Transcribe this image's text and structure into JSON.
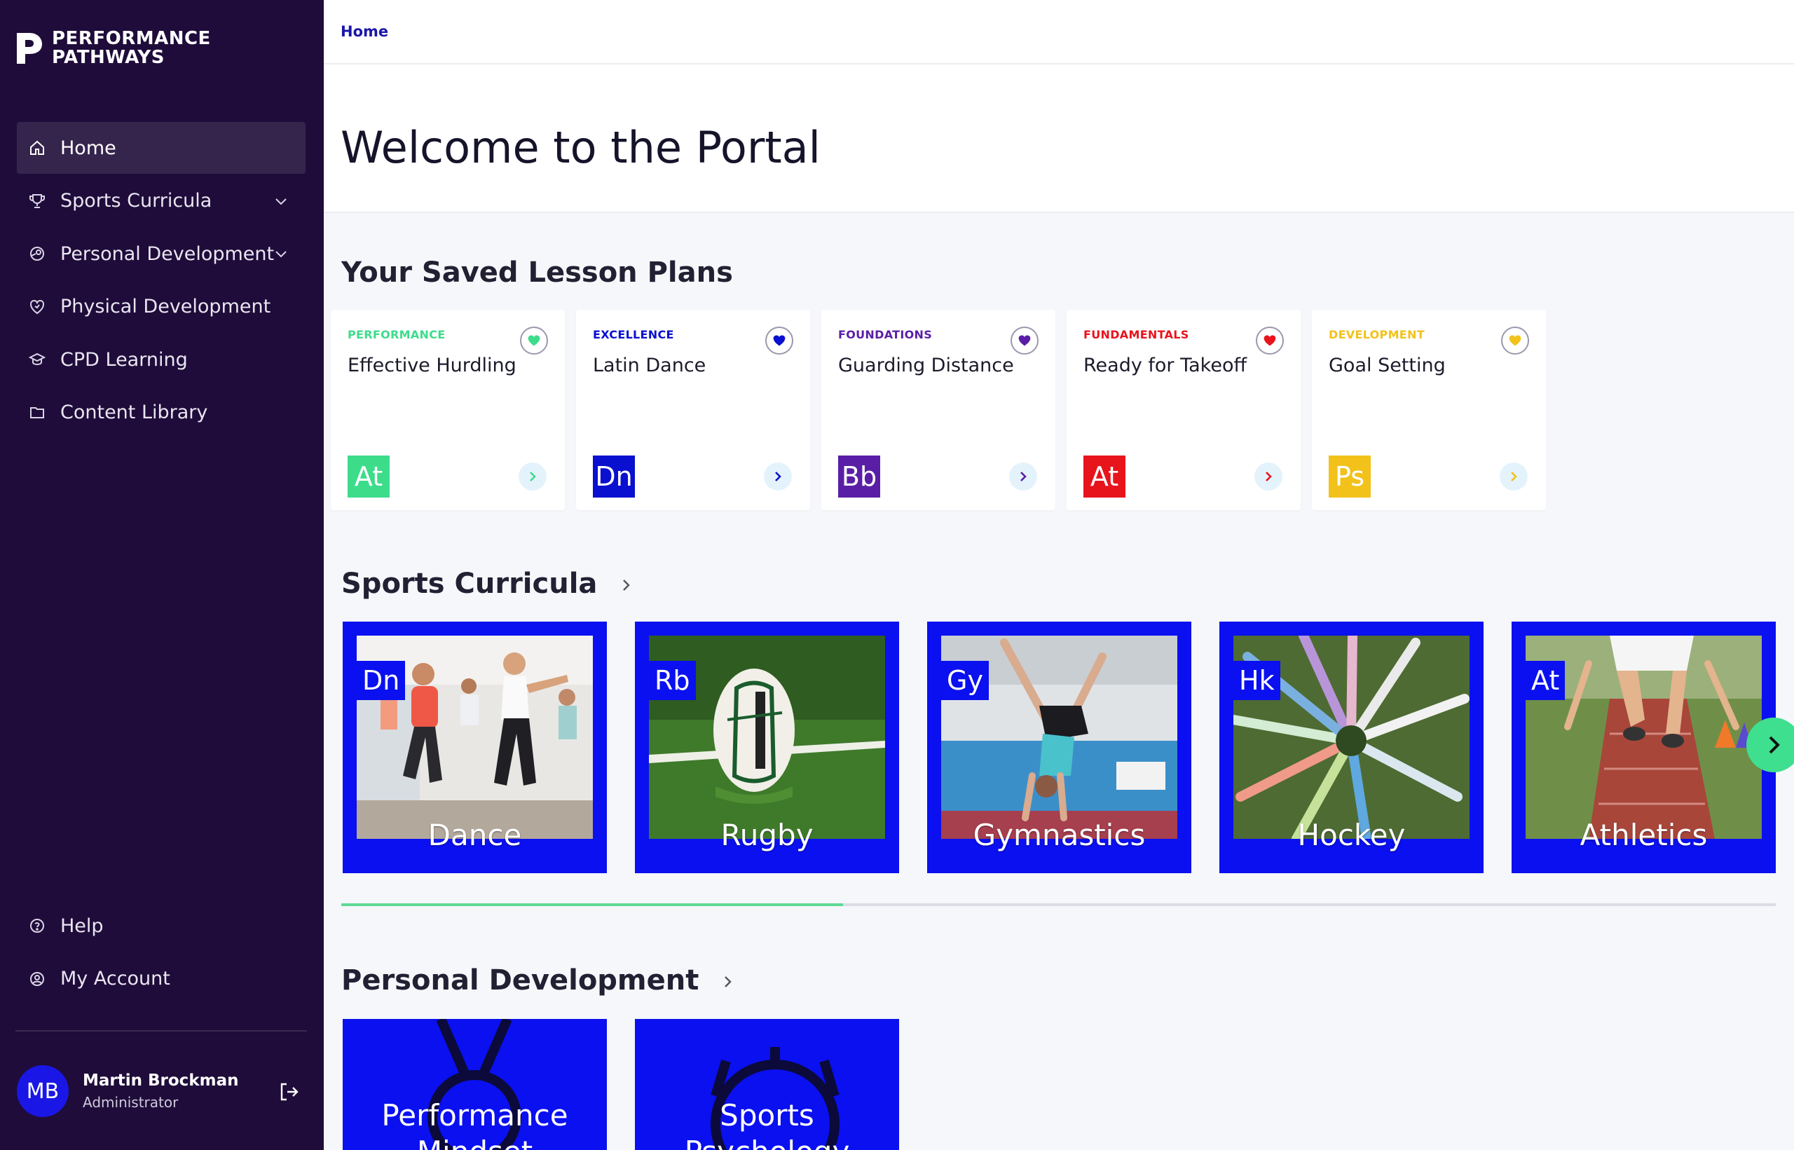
{
  "brand": {
    "line1": "PERFORMANCE",
    "line2": "PATHWAYS"
  },
  "nav": {
    "items": [
      {
        "label": "Home",
        "icon": "home-icon",
        "active": true
      },
      {
        "label": "Sports Curricula",
        "icon": "trophy-icon",
        "expandable": true
      },
      {
        "label": "Personal Development",
        "icon": "person-icon",
        "expandable": true
      },
      {
        "label": "Physical Development",
        "icon": "heart-shield-icon"
      },
      {
        "label": "CPD Learning",
        "icon": "graduation-cap-icon"
      },
      {
        "label": "Content Library",
        "icon": "folder-icon"
      }
    ],
    "bottom": [
      {
        "label": "Help",
        "icon": "help-icon"
      },
      {
        "label": "My Account",
        "icon": "account-icon"
      }
    ]
  },
  "user": {
    "initials": "MB",
    "name": "Martin Brockman",
    "role": "Administrator"
  },
  "breadcrumb": "Home",
  "page_title": "Welcome to the Portal",
  "saved": {
    "title": "Your Saved Lesson Plans",
    "cards": [
      {
        "category": "PERFORMANCE",
        "title": "Effective Hurdling",
        "badge": "At",
        "color": "#3ddc8b"
      },
      {
        "category": "EXCELLENCE",
        "title": "Latin Dance",
        "badge": "Dn",
        "color": "#0a10cf"
      },
      {
        "category": "FOUNDATIONS",
        "title": "Guarding Distance",
        "badge": "Bb",
        "color": "#5a1ea6"
      },
      {
        "category": "FUNDAMENTALS",
        "title": "Ready for Takeoff",
        "badge": "At",
        "color": "#e8141c"
      },
      {
        "category": "DEVELOPMENT",
        "title": "Goal Setting",
        "badge": "Ps",
        "color": "#f2c21b"
      }
    ]
  },
  "curricula": {
    "title": "Sports Curricula",
    "tiles": [
      {
        "badge": "Dn",
        "label": "Dance"
      },
      {
        "badge": "Rb",
        "label": "Rugby"
      },
      {
        "badge": "Gy",
        "label": "Gymnastics"
      },
      {
        "badge": "Hk",
        "label": "Hockey"
      },
      {
        "badge": "At",
        "label": "Athletics"
      }
    ],
    "scroll_progress": 0.35
  },
  "personal": {
    "title": "Personal Development",
    "tiles": [
      {
        "label": "Performance Mindset"
      },
      {
        "label": "Sports Psychology"
      }
    ]
  }
}
